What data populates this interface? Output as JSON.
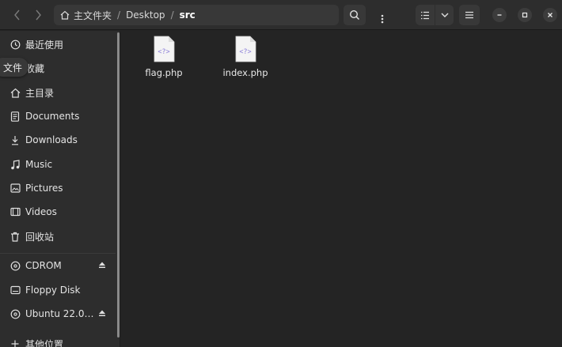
{
  "header": {
    "path": {
      "segments": [
        "主文件夹",
        "Desktop"
      ],
      "current": "src",
      "separator": "/"
    }
  },
  "sidebar": {
    "items": [
      {
        "label": "最近使用",
        "icon": "clock-icon"
      },
      {
        "label": "收藏",
        "icon": "star-icon"
      },
      {
        "label": "主目录",
        "icon": "home-icon"
      },
      {
        "label": "Documents",
        "icon": "document-icon"
      },
      {
        "label": "Downloads",
        "icon": "download-icon"
      },
      {
        "label": "Music",
        "icon": "music-icon"
      },
      {
        "label": "Pictures",
        "icon": "picture-icon"
      },
      {
        "label": "Videos",
        "icon": "video-icon"
      },
      {
        "label": "回收站",
        "icon": "trash-icon"
      }
    ],
    "devices": [
      {
        "label": "CDROM",
        "icon": "disc-icon",
        "ejectable": true
      },
      {
        "label": "Floppy Disk",
        "icon": "drive-icon",
        "ejectable": false
      },
      {
        "label": "Ubuntu 22.0…",
        "icon": "disc-icon",
        "ejectable": true
      }
    ],
    "other": {
      "label": "其他位置",
      "icon": "plus-icon"
    },
    "tooltip": "文件"
  },
  "files": [
    {
      "name": "flag.php",
      "icon": "php-file-icon",
      "glyph": "<?>"
    },
    {
      "name": "index.php",
      "icon": "php-file-icon",
      "glyph": "<?>"
    }
  ],
  "colors": {
    "accent": "#8a7dd8",
    "window_bg": "#242424",
    "sidebar_bg": "#2d2d2d"
  }
}
